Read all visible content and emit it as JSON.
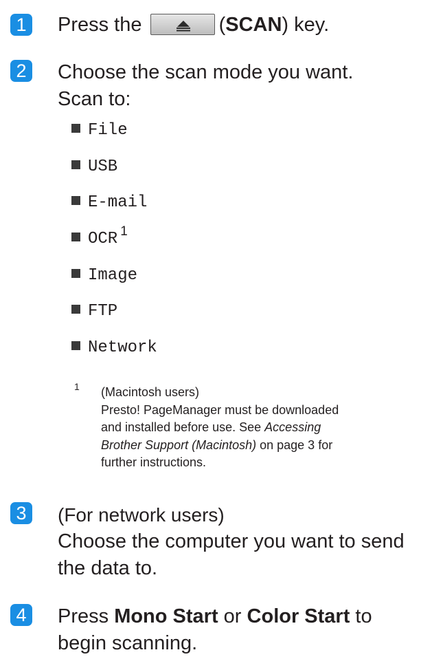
{
  "step1": {
    "number": "1",
    "before": "Press the",
    "key_icon": "scan-key-icon",
    "paren_open": "(",
    "key_name": "SCAN",
    "after": ") key."
  },
  "step2": {
    "number": "2",
    "line1": "Choose the scan mode you want.",
    "line2": "Scan to:",
    "options": [
      "File",
      "USB",
      "E-mail",
      "OCR",
      "Image",
      "FTP",
      "Network"
    ],
    "ocr_footnote_ref": "1"
  },
  "footnote": {
    "mark": "1",
    "line1": "(Macintosh users)",
    "line2_a": "Presto! PageManager must be downloaded",
    "line3_a": "and installed before use. See ",
    "link_part1": "Accessing",
    "link_part2": "Brother Support (Macintosh)",
    "line4_b": " on page 3 for",
    "line5": "further instructions."
  },
  "step3": {
    "number": "3",
    "line1": "(For network users)",
    "line2": "Choose the computer you want to send",
    "line3": "the data to."
  },
  "step4": {
    "number": "4",
    "press": "Press ",
    "mono_start": "Mono Start",
    "or": " or ",
    "color_start": "Color Start",
    "to": " to",
    "line2": "begin scanning."
  },
  "colors": {
    "badge": "#1a8ee3",
    "text": "#231f20"
  }
}
